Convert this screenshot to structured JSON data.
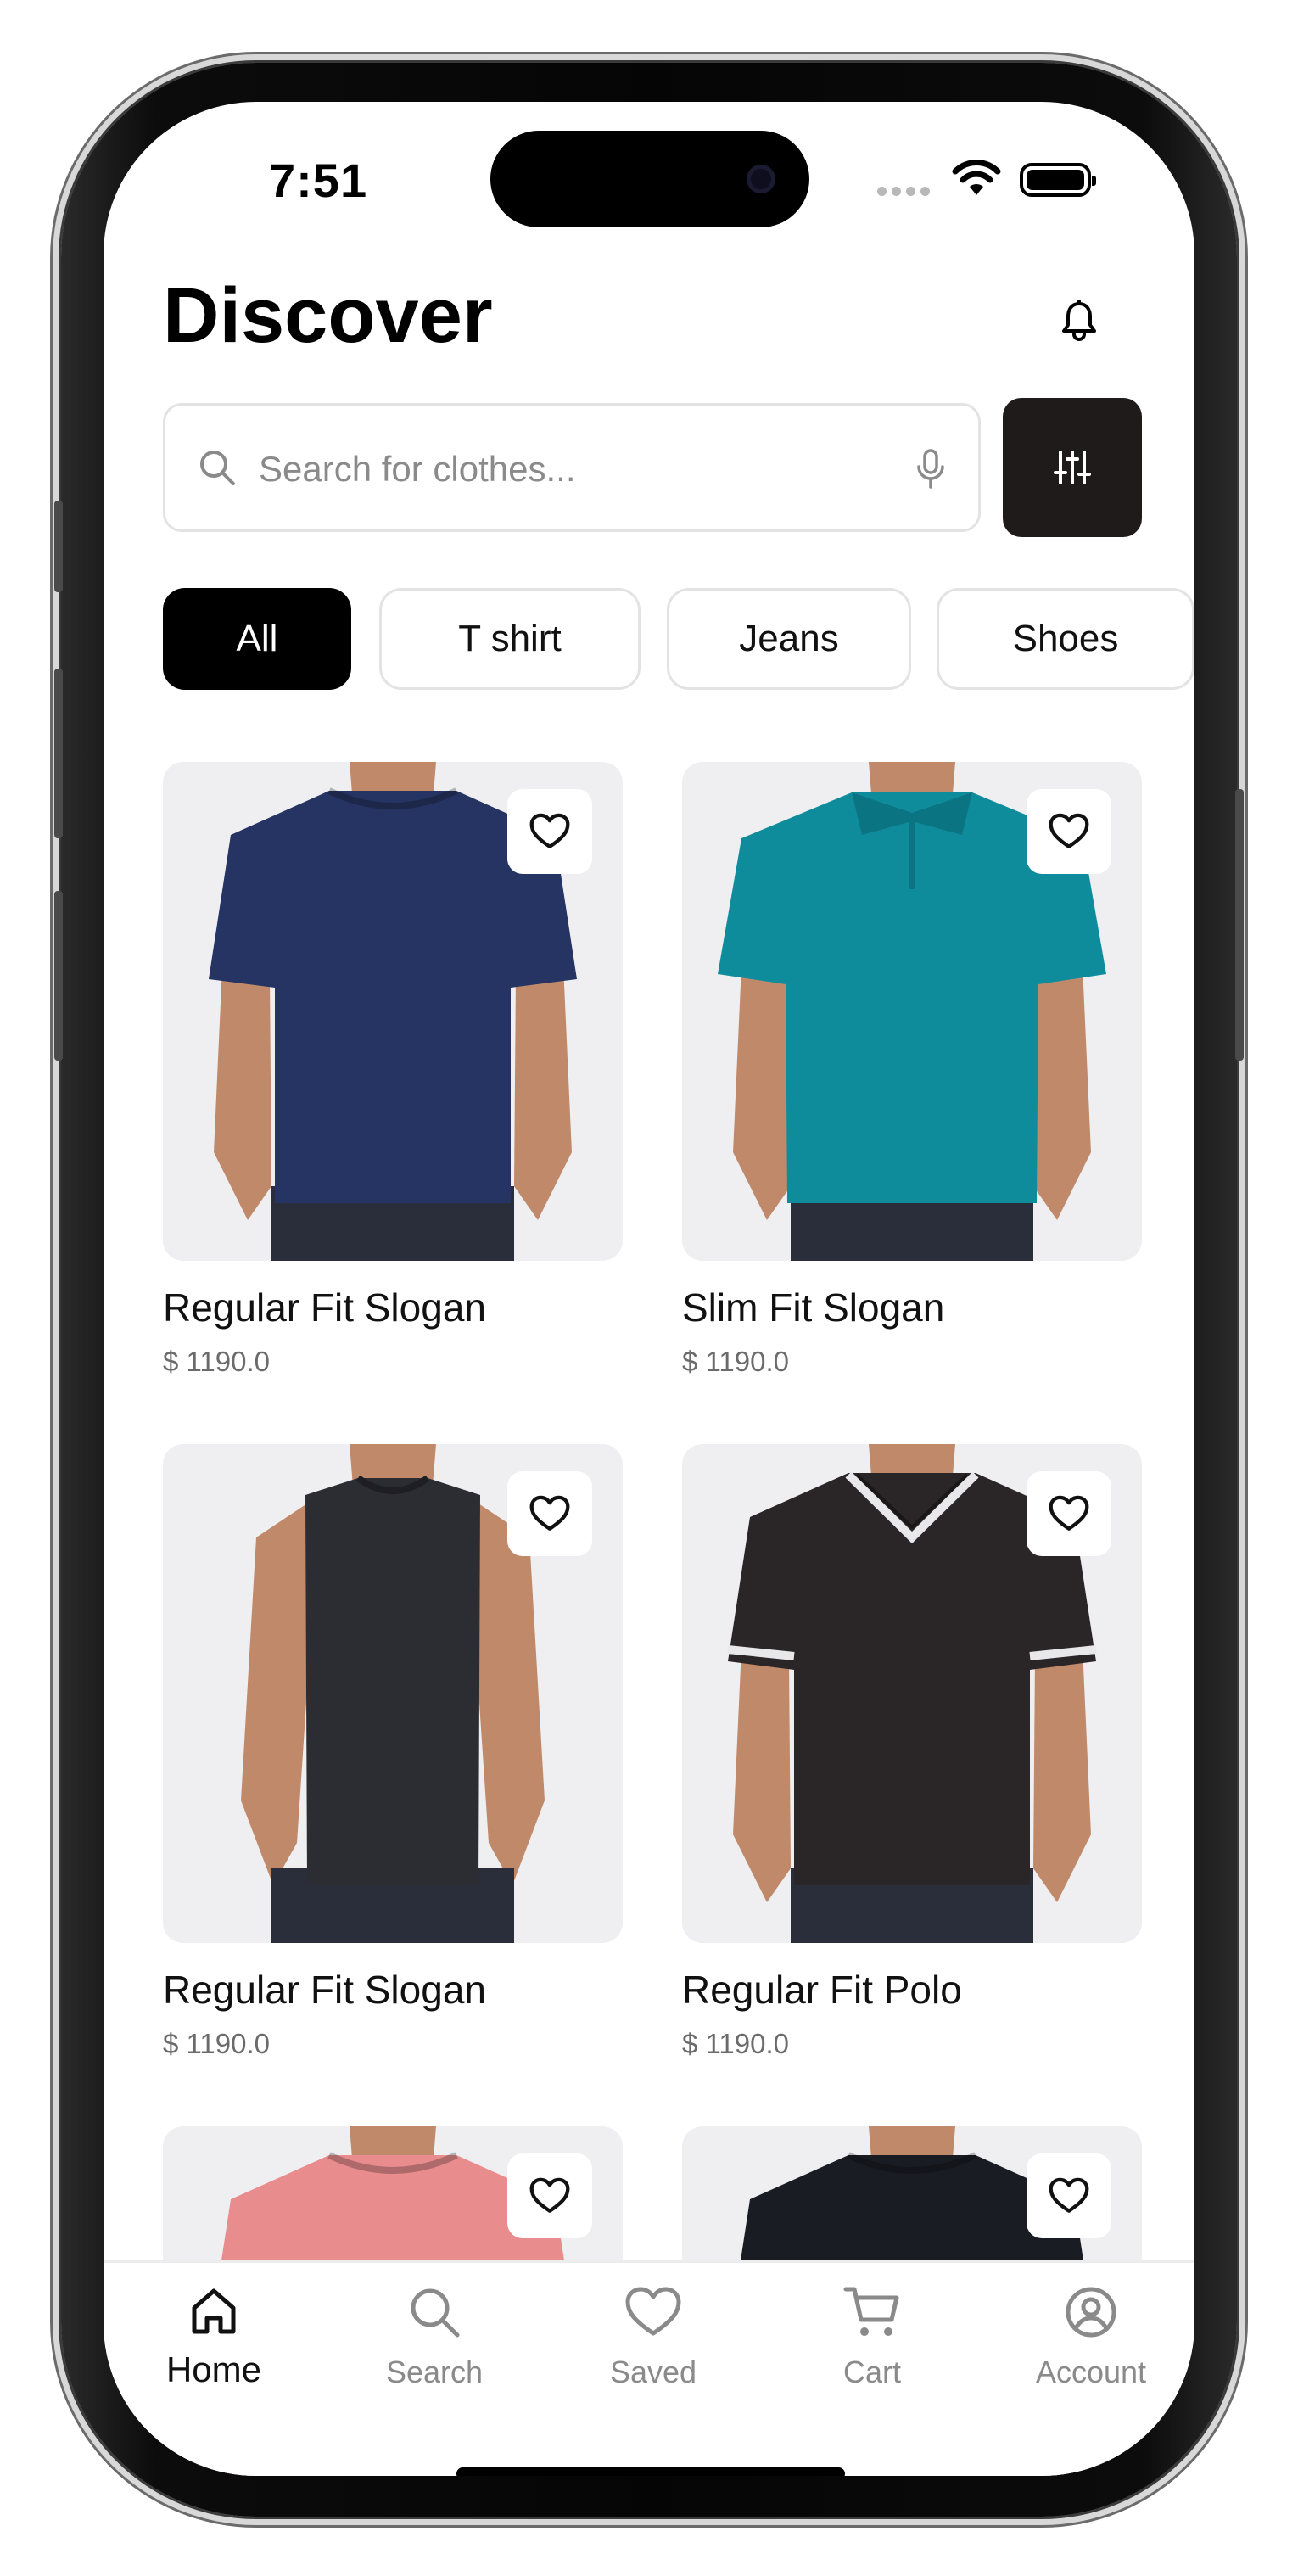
{
  "status_bar": {
    "time": "7:51"
  },
  "header": {
    "title": "Discover"
  },
  "search": {
    "placeholder": "Search for clothes..."
  },
  "filters": [
    "All",
    "T shirt",
    "Jeans",
    "Shoes"
  ],
  "active_filter": "All",
  "products": [
    {
      "name": "Regular Fit Slogan",
      "price": "$ 1190.0",
      "shirt_color": "#263463",
      "style": "tee"
    },
    {
      "name": "Slim Fit Slogan",
      "price": "$ 1190.0",
      "shirt_color": "#0f8c9c",
      "style": "polo"
    },
    {
      "name": "Regular Fit Slogan",
      "price": "$ 1190.0",
      "shirt_color": "#2c2c33",
      "style": "tank"
    },
    {
      "name": "Regular Fit Polo",
      "price": "$ 1190.0",
      "shirt_color": "#2a2628",
      "style": "vneck"
    },
    {
      "name": "",
      "price": "",
      "shirt_color": "#e88c8e",
      "style": "tee"
    },
    {
      "name": "",
      "price": "",
      "shirt_color": "#1a1c24",
      "style": "tee"
    }
  ],
  "nav": {
    "home": "Home",
    "search": "Search",
    "saved": "Saved",
    "cart": "Cart",
    "account": "Account"
  },
  "colors": {
    "accent": "#000000",
    "filter_button": "#1f1b1a",
    "muted_text": "#8a8a8a"
  }
}
